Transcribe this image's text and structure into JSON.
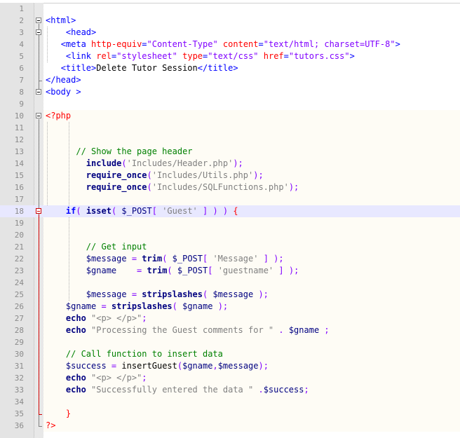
{
  "editor": {
    "highlighted_line": 18,
    "php_block": {
      "from": 10,
      "to": 36
    },
    "lines": [
      {
        "n": "1",
        "tokens": []
      },
      {
        "n": "2",
        "tokens": [
          [
            "t-tag",
            "<html>"
          ]
        ]
      },
      {
        "n": "3",
        "tokens": [
          [
            "t-txt",
            "    "
          ],
          [
            "t-tag",
            "<head>"
          ]
        ]
      },
      {
        "n": "4",
        "tokens": [
          [
            "t-txt",
            "   "
          ],
          [
            "t-tag",
            "<meta "
          ],
          [
            "t-attr",
            "http-equiv"
          ],
          [
            "t-tag",
            "="
          ],
          [
            "t-val",
            "\"Content-Type\""
          ],
          [
            "t-tag",
            " "
          ],
          [
            "t-attr",
            "content"
          ],
          [
            "t-tag",
            "="
          ],
          [
            "t-val",
            "\"text/html; charset=UTF-8\""
          ],
          [
            "t-tag",
            ">"
          ]
        ]
      },
      {
        "n": "5",
        "tokens": [
          [
            "t-txt",
            "    "
          ],
          [
            "t-tag",
            "<link "
          ],
          [
            "t-attr",
            "rel"
          ],
          [
            "t-tag",
            "="
          ],
          [
            "t-val",
            "\"stylesheet\""
          ],
          [
            "t-tag",
            " "
          ],
          [
            "t-attr",
            "type"
          ],
          [
            "t-tag",
            "="
          ],
          [
            "t-val",
            "\"text/css\""
          ],
          [
            "t-tag",
            " "
          ],
          [
            "t-attr",
            "href"
          ],
          [
            "t-tag",
            "="
          ],
          [
            "t-val",
            "\"tutors.css\""
          ],
          [
            "t-tag",
            ">"
          ]
        ]
      },
      {
        "n": "6",
        "tokens": [
          [
            "t-txt",
            "   "
          ],
          [
            "t-tag",
            "<title>"
          ],
          [
            "t-txt",
            "Delete Tutor Session"
          ],
          [
            "t-tag",
            "</title>"
          ]
        ]
      },
      {
        "n": "7",
        "tokens": [
          [
            "t-tag",
            "</head>"
          ]
        ]
      },
      {
        "n": "8",
        "tokens": [
          [
            "t-tag",
            "<body >"
          ]
        ]
      },
      {
        "n": "9",
        "tokens": []
      },
      {
        "n": "10",
        "tokens": [
          [
            "t-php",
            "<?php"
          ]
        ]
      },
      {
        "n": "11",
        "tokens": []
      },
      {
        "n": "12",
        "tokens": []
      },
      {
        "n": "13",
        "tokens": [
          [
            "t-txt",
            "      "
          ],
          [
            "t-cmt",
            "// Show the page header"
          ]
        ]
      },
      {
        "n": "14",
        "tokens": [
          [
            "t-txt",
            "        "
          ],
          [
            "t-fn",
            "include"
          ],
          [
            "t-op",
            "("
          ],
          [
            "t-str",
            "'Includes/Header.php'"
          ],
          [
            "t-op",
            ");"
          ]
        ]
      },
      {
        "n": "15",
        "tokens": [
          [
            "t-txt",
            "        "
          ],
          [
            "t-fn",
            "require_once"
          ],
          [
            "t-op",
            "("
          ],
          [
            "t-str",
            "'Includes/Utils.php'"
          ],
          [
            "t-op",
            ");"
          ]
        ]
      },
      {
        "n": "16",
        "tokens": [
          [
            "t-txt",
            "        "
          ],
          [
            "t-fn",
            "require_once"
          ],
          [
            "t-op",
            "("
          ],
          [
            "t-str",
            "'Includes/SQLFunctions.php'"
          ],
          [
            "t-op",
            ");"
          ]
        ]
      },
      {
        "n": "17",
        "tokens": []
      },
      {
        "n": "18",
        "tokens": [
          [
            "t-txt",
            "    "
          ],
          [
            "t-kw",
            "if"
          ],
          [
            "t-op",
            "( "
          ],
          [
            "t-fn",
            "isset"
          ],
          [
            "t-op",
            "( "
          ],
          [
            "t-var",
            "$_POST"
          ],
          [
            "t-op",
            "[ "
          ],
          [
            "t-str",
            "'Guest'"
          ],
          [
            "t-op",
            " ] ) ) "
          ],
          [
            "t-php",
            "{"
          ]
        ]
      },
      {
        "n": "19",
        "tokens": []
      },
      {
        "n": "20",
        "tokens": []
      },
      {
        "n": "21",
        "tokens": [
          [
            "t-txt",
            "        "
          ],
          [
            "t-cmt",
            "// Get input"
          ]
        ]
      },
      {
        "n": "22",
        "tokens": [
          [
            "t-txt",
            "        "
          ],
          [
            "t-var",
            "$message"
          ],
          [
            "t-op",
            " = "
          ],
          [
            "t-fn",
            "trim"
          ],
          [
            "t-op",
            "( "
          ],
          [
            "t-var",
            "$_POST"
          ],
          [
            "t-op",
            "[ "
          ],
          [
            "t-str",
            "'Message'"
          ],
          [
            "t-op",
            " ] );"
          ]
        ]
      },
      {
        "n": "23",
        "tokens": [
          [
            "t-txt",
            "        "
          ],
          [
            "t-var",
            "$gname"
          ],
          [
            "t-op",
            "    = "
          ],
          [
            "t-fn",
            "trim"
          ],
          [
            "t-op",
            "( "
          ],
          [
            "t-var",
            "$_POST"
          ],
          [
            "t-op",
            "[ "
          ],
          [
            "t-str",
            "'guestname'"
          ],
          [
            "t-op",
            " ] );"
          ]
        ]
      },
      {
        "n": "24",
        "tokens": []
      },
      {
        "n": "25",
        "tokens": [
          [
            "t-txt",
            "        "
          ],
          [
            "t-var",
            "$message"
          ],
          [
            "t-op",
            " = "
          ],
          [
            "t-fn",
            "stripslashes"
          ],
          [
            "t-op",
            "( "
          ],
          [
            "t-var",
            "$message"
          ],
          [
            "t-op",
            " );"
          ]
        ]
      },
      {
        "n": "26",
        "tokens": [
          [
            "t-txt",
            "    "
          ],
          [
            "t-var",
            "$gname"
          ],
          [
            "t-op",
            " = "
          ],
          [
            "t-fn",
            "stripslashes"
          ],
          [
            "t-op",
            "( "
          ],
          [
            "t-var",
            "$gname"
          ],
          [
            "t-op",
            " );"
          ]
        ]
      },
      {
        "n": "27",
        "tokens": [
          [
            "t-txt",
            "    "
          ],
          [
            "t-fn",
            "echo"
          ],
          [
            "t-op",
            " "
          ],
          [
            "t-str",
            "\"<p> </p>\""
          ],
          [
            "t-op",
            ";"
          ]
        ]
      },
      {
        "n": "28",
        "tokens": [
          [
            "t-txt",
            "    "
          ],
          [
            "t-fn",
            "echo"
          ],
          [
            "t-op",
            " "
          ],
          [
            "t-str",
            "\"Processing the Guest comments for \""
          ],
          [
            "t-op",
            " . "
          ],
          [
            "t-var",
            "$gname"
          ],
          [
            "t-op",
            " ;"
          ]
        ]
      },
      {
        "n": "29",
        "tokens": []
      },
      {
        "n": "30",
        "tokens": [
          [
            "t-txt",
            "    "
          ],
          [
            "t-cmt",
            "// Call function to insert data"
          ]
        ]
      },
      {
        "n": "31",
        "tokens": [
          [
            "t-txt",
            "    "
          ],
          [
            "t-var",
            "$success"
          ],
          [
            "t-op",
            " = "
          ],
          [
            "t-txt",
            "insertGuest"
          ],
          [
            "t-op",
            "("
          ],
          [
            "t-var",
            "$gname"
          ],
          [
            "t-op",
            ","
          ],
          [
            "t-var",
            "$message"
          ],
          [
            "t-op",
            ");"
          ]
        ]
      },
      {
        "n": "32",
        "tokens": [
          [
            "t-txt",
            "    "
          ],
          [
            "t-fn",
            "echo"
          ],
          [
            "t-op",
            " "
          ],
          [
            "t-str",
            "\"<p> </p>\""
          ],
          [
            "t-op",
            ";"
          ]
        ]
      },
      {
        "n": "33",
        "tokens": [
          [
            "t-txt",
            "    "
          ],
          [
            "t-fn",
            "echo"
          ],
          [
            "t-op",
            " "
          ],
          [
            "t-str",
            "\"Successfully entered the data \""
          ],
          [
            "t-op",
            " ."
          ],
          [
            "t-var",
            "$success"
          ],
          [
            "t-op",
            ";"
          ]
        ]
      },
      {
        "n": "34",
        "tokens": []
      },
      {
        "n": "35",
        "tokens": [
          [
            "t-txt",
            "    "
          ],
          [
            "t-php",
            "}"
          ]
        ]
      },
      {
        "n": "36",
        "tokens": [
          [
            "t-php",
            "?>"
          ]
        ]
      }
    ]
  }
}
